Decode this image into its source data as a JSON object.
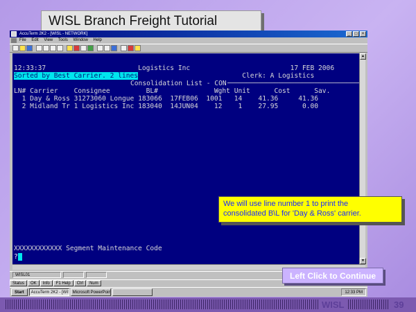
{
  "slide": {
    "title": "WISL Branch Freight Tutorial",
    "footer_label": "WISL",
    "page_number": "39"
  },
  "window": {
    "title": "AccuTerm 2K2 - [WISL - NETWORK]",
    "buttons": [
      "_",
      "□",
      "×"
    ],
    "menu": [
      "File",
      "Edit",
      "View",
      "Tools",
      "Window",
      "Help"
    ]
  },
  "terminal": {
    "time": "12:33:37",
    "company": "Logistics Inc",
    "date": "17 FEB 2006",
    "sorted_by": "Sorted by Best Carrier. 2 lines",
    "clerk": "Clerk: A Logistics",
    "list_title": "Consolidation List - CON",
    "columns": [
      "LN#",
      "Carrier",
      "Consignee",
      "BL#",
      "Wght",
      "Unit",
      "Cost",
      "Sav."
    ],
    "rows": [
      {
        "ln": "1",
        "carrier": "Day & Ross",
        "consignee": "31273060 Longue",
        "bl": "183066",
        "date": "17FEB06",
        "wght": "1001",
        "unit": "14",
        "cost": "41.36",
        "sav": "41.36"
      },
      {
        "ln": "2",
        "carrier": "Midland Tr",
        "consignee": "1 Logistics Inc",
        "bl": "183040",
        "date": "14JUN04",
        "wght": "12",
        "unit": "1",
        "cost": "27.95",
        "sav": "0.00"
      }
    ],
    "segment_prompt": "XXXXXXXXXXXX Segment Maintenance Code",
    "prompt_char": "?"
  },
  "status_cells": [
    "WISL01",
    "",
    ""
  ],
  "task_row": [
    "Status",
    "OK",
    "Info",
    "F1 Help",
    "Ctrl",
    "Num"
  ],
  "taskbar": {
    "start": "Start",
    "tasks": [
      "AccuTerm 2K2 - [WIS...",
      "Microsoft PowerPoint...",
      ""
    ],
    "clock": "12:33 PM"
  },
  "callout": {
    "text_line1": "We will use line number 1  to print the",
    "text_line2": "consolidated B\\L for 'Day & Ross' carrier."
  },
  "continue_label": "Left Click to Continue"
}
